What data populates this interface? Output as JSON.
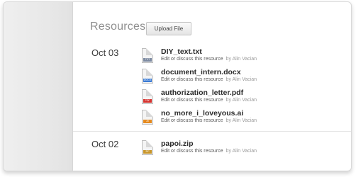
{
  "header": {
    "title": "Resources",
    "upload_label": "Upload File"
  },
  "groups": [
    {
      "date": "Oct 03",
      "files": [
        {
          "name": "DIY_text.txt",
          "type": "TXT",
          "tag_color": "#7d8aa1",
          "action": "Edit or discuss this resource",
          "by": "by Alin Vacian"
        },
        {
          "name": "document_intern.docx",
          "type": "DOCX",
          "tag_color": "#3b7bd4",
          "action": "Edit or discuss this resource",
          "by": "by Alin Vacian"
        },
        {
          "name": "authorization_letter.pdf",
          "type": "PDF",
          "tag_color": "#d6332f",
          "action": "Edit or discuss this resource",
          "by": "by Alin Vacian"
        },
        {
          "name": "no_more_i_loveyous.ai",
          "type": "AI",
          "tag_color": "#e58a1f",
          "action": "Edit or discuss this resource",
          "by": "by Alin Vacian"
        }
      ]
    },
    {
      "date": "Oct 02",
      "files": [
        {
          "name": "papoi.zip",
          "type": "ZIP",
          "tag_color": "#c8962a",
          "action": "Edit or discuss this resource",
          "by": "by Alin Vacian"
        }
      ]
    }
  ]
}
